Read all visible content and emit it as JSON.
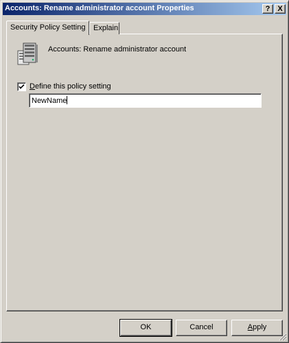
{
  "window": {
    "title": "Accounts: Rename administrator account Properties",
    "help_label": "?",
    "close_label": "X"
  },
  "tabs": [
    {
      "label": "Security Policy Setting",
      "active": true
    },
    {
      "label": "Explain",
      "active": false
    }
  ],
  "policy": {
    "name": "Accounts: Rename administrator account",
    "icon": "server-policy-icon"
  },
  "define_setting": {
    "checked": true,
    "accel": "D",
    "label_rest": "efine this policy setting"
  },
  "name_field": {
    "value": "NewName"
  },
  "buttons": {
    "ok": "OK",
    "cancel": "Cancel",
    "apply_accel": "A",
    "apply_rest": "pply"
  }
}
